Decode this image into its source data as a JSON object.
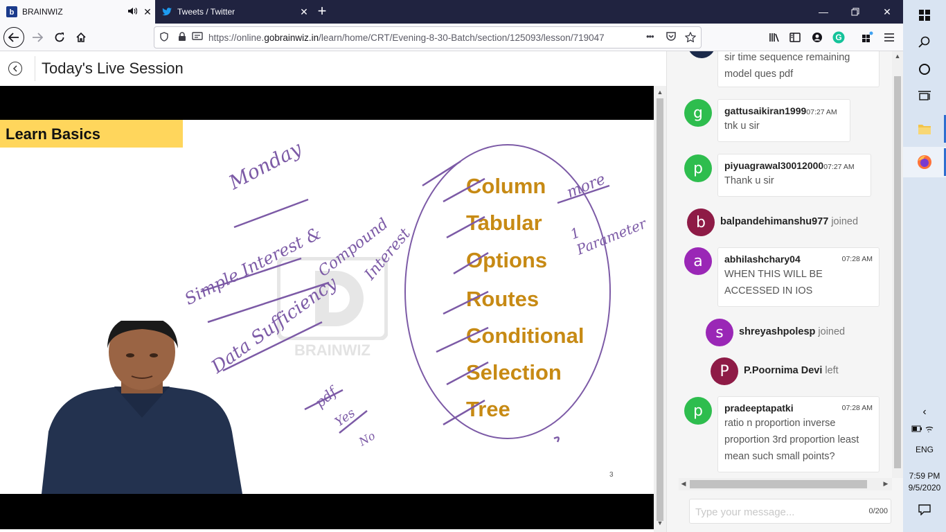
{
  "browser": {
    "tabs": [
      {
        "label": "BRAINWIZ",
        "favicon": "brainwiz-icon"
      },
      {
        "label": "Tweets / Twitter",
        "favicon": "twitter-icon"
      }
    ],
    "url_prefix": "https://online.",
    "url_domain": "gobrainwiz.in",
    "url_path": "/learn/home/CRT/Evening-8-30-Batch/section/125093/lesson/719047",
    "more_label": "•••"
  },
  "page": {
    "title": "Today's Live Session"
  },
  "slide": {
    "banner": "Learn Basics",
    "keywords": [
      "Column",
      "Tabular",
      "Options",
      "Routes",
      "Conditional",
      "Selection",
      "Tree"
    ],
    "handwriting": {
      "monday": "Monday",
      "simple_interest": "Simple Interest &",
      "compound": "Compound",
      "interest": "Interest",
      "data_sufficiency": "Data Sufficiency",
      "pdf": "pdf",
      "yes": "Yes",
      "no": "No",
      "more": "more",
      "parameter": "1 Parameter"
    },
    "watermark": "BRAINWIZ",
    "page_number": "3"
  },
  "chat": {
    "messages": [
      {
        "type": "msg",
        "text": "sir time sequence remaining model ques pdf"
      },
      {
        "type": "msg",
        "initial": "g",
        "color": "#2ebd4e",
        "user": "gattusaikiran1999",
        "time": "07:27 AM",
        "text": "tnk u sir"
      },
      {
        "type": "msg",
        "initial": "p",
        "color": "#2ebd4e",
        "user": "piyuagrawal30012000",
        "time": "07:27 AM",
        "text": "Thank u sir"
      },
      {
        "type": "join",
        "initial": "b",
        "color": "#8e1b46",
        "user": "balpandehimanshu977",
        "status": "joined"
      },
      {
        "type": "msg",
        "initial": "a",
        "color": "#9a27b6",
        "user": "abhilashchary04",
        "time": "07:28 AM",
        "text": "WHEN THIS WILL BE ACCESSED IN IOS"
      },
      {
        "type": "join",
        "initial": "s",
        "color": "#9a27b6",
        "user": "shreyashpolesp",
        "status": "joined"
      },
      {
        "type": "join",
        "initial": "P",
        "color": "#8e1b46",
        "user": "P.Poornima Devi",
        "status": "left"
      },
      {
        "type": "msg",
        "initial": "p",
        "color": "#2ebd4e",
        "user": "pradeeptapatki",
        "time": "07:28 AM",
        "text": "ratio n proportion inverse proportion 3rd proportion least mean such small points?"
      }
    ],
    "input_placeholder": "Type your message...",
    "counter": "0/200"
  },
  "taskbar": {
    "language": "ENG",
    "time": "7:59 PM",
    "date": "9/5/2020"
  }
}
